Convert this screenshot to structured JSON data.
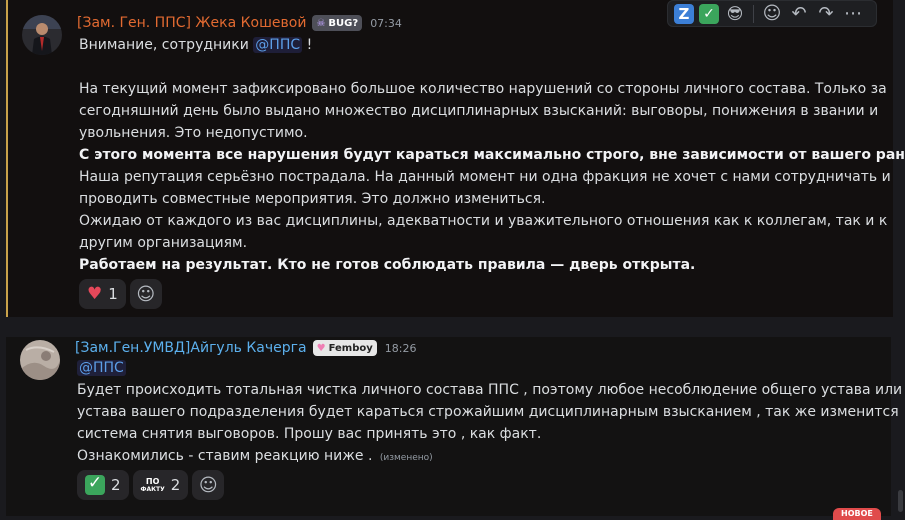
{
  "toolbar": {
    "icons": [
      "z-icon",
      "check-icon",
      "sunglasses-icon",
      "add-reaction-icon",
      "reply-icon",
      "forward-icon",
      "more-icon"
    ],
    "z_label": "Z",
    "check_label": "✓",
    "sun_glyph": "😎",
    "add_glyph": "☺",
    "reply_glyph": "↶",
    "forward_glyph": "↷",
    "more_glyph": "⋯"
  },
  "messages": [
    {
      "author": "[Зам. Ген. ППС] Жека Кошевой",
      "tag": "BUG?",
      "time": "07:34",
      "lines": {
        "l0_pre": "Внимание, сотрудники",
        "l0_mention": "@ППС",
        "l0_post": "!",
        "l1": "",
        "l2": "На текущий момент зафиксировано большое количество нарушений со стороны личного состава. Только за",
        "l3": "сегодняшний день было выдано множество дисциплинарных взысканий: выговоры, понижения в звании и",
        "l4": "увольнения. Это недопустимо.",
        "l5": "С этого момента все нарушения будут караться максимально строго, вне зависимости от вашего ранга.",
        "l6": "Наша репутация серьёзно пострадала. На данный момент ни одна фракция не хочет с нами сотрудничать и",
        "l7": "проводить совместные мероприятия. Это должно измениться.",
        "l8": "Ожидаю от каждого из вас дисциплины, адекватности и уважительного отношения как к коллегам, так и к",
        "l9": "другим организациям.",
        "l10": "Работаем на результат. Кто не готов соблюдать правила — дверь открыта."
      },
      "reactions": [
        {
          "emoji": "heart",
          "glyph": "♥",
          "count": "1"
        }
      ]
    },
    {
      "author": "[Зам.Ген.УМВД]Айгуль Качерга",
      "tag": "Femboy",
      "time": "18:26",
      "lines": {
        "l0_mention": "@ППС",
        "l1": "Будет происходить тотальная чистка личного состава ППС , поэтому любое несоблюдение общего устава или",
        "l2": "устава вашего подразделения будет караться строжайшим дисциплинарным взысканием , так же изменится",
        "l3": "система снятия выговоров. Прошу  вас принять это , как факт.",
        "l4": "Ознакомились - ставим реакцию ниже .",
        "edited": "(изменено)"
      },
      "reactions": [
        {
          "emoji": "check",
          "glyph": "✓",
          "count": "2"
        },
        {
          "emoji": "po-faktu",
          "glyph_top": "ПО",
          "glyph_bottom": "ФАКТУ",
          "count": "2"
        }
      ]
    }
  ],
  "new_badge": "НОВОЕ"
}
